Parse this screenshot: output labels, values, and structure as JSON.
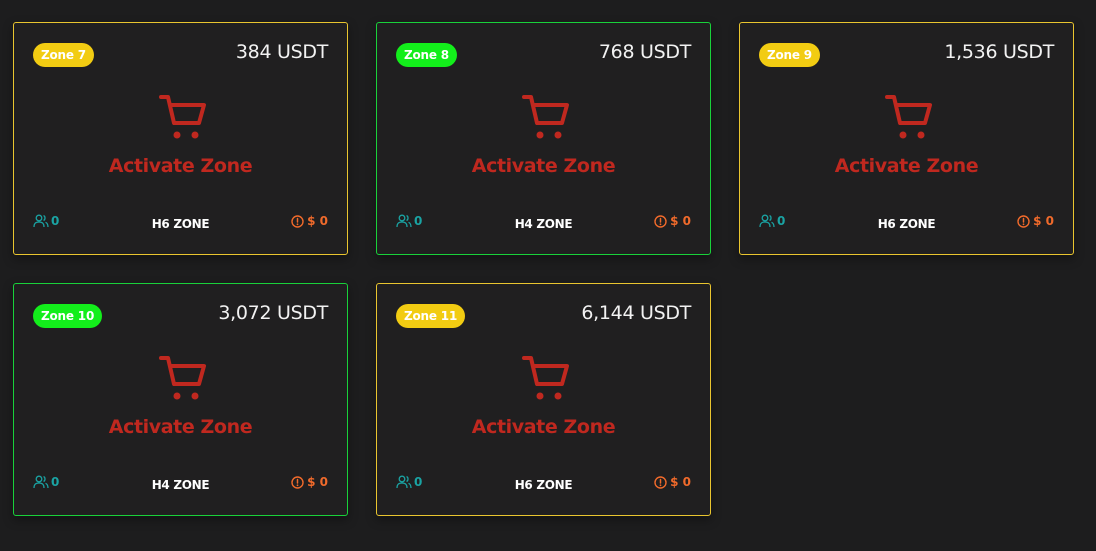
{
  "colors": {
    "background": "#1d1d1e",
    "card": "#201f20",
    "yellow": "#f2cc12",
    "green": "#13ee1b",
    "activate": "#c0281f",
    "users": "#1aa3a3",
    "earnings": "#f06a2b"
  },
  "cards": [
    {
      "zone_label": "Zone 7",
      "price": "384 USDT",
      "action": "Activate Zone",
      "users": "0",
      "zone_type": "H6 ZONE",
      "earnings": "$ 0",
      "theme": "yellow"
    },
    {
      "zone_label": "Zone 8",
      "price": "768 USDT",
      "action": "Activate Zone",
      "users": "0",
      "zone_type": "H4 ZONE",
      "earnings": "$ 0",
      "theme": "green"
    },
    {
      "zone_label": "Zone 9",
      "price": "1,536 USDT",
      "action": "Activate Zone",
      "users": "0",
      "zone_type": "H6 ZONE",
      "earnings": "$ 0",
      "theme": "yellow"
    },
    {
      "zone_label": "Zone 10",
      "price": "3,072 USDT",
      "action": "Activate Zone",
      "users": "0",
      "zone_type": "H4 ZONE",
      "earnings": "$ 0",
      "theme": "green"
    },
    {
      "zone_label": "Zone 11",
      "price": "6,144 USDT",
      "action": "Activate Zone",
      "users": "0",
      "zone_type": "H6 ZONE",
      "earnings": "$ 0",
      "theme": "yellow"
    }
  ],
  "icons": {
    "cart": "shopping-cart-icon",
    "users": "users-icon",
    "earnings": "alert-circle-icon"
  }
}
